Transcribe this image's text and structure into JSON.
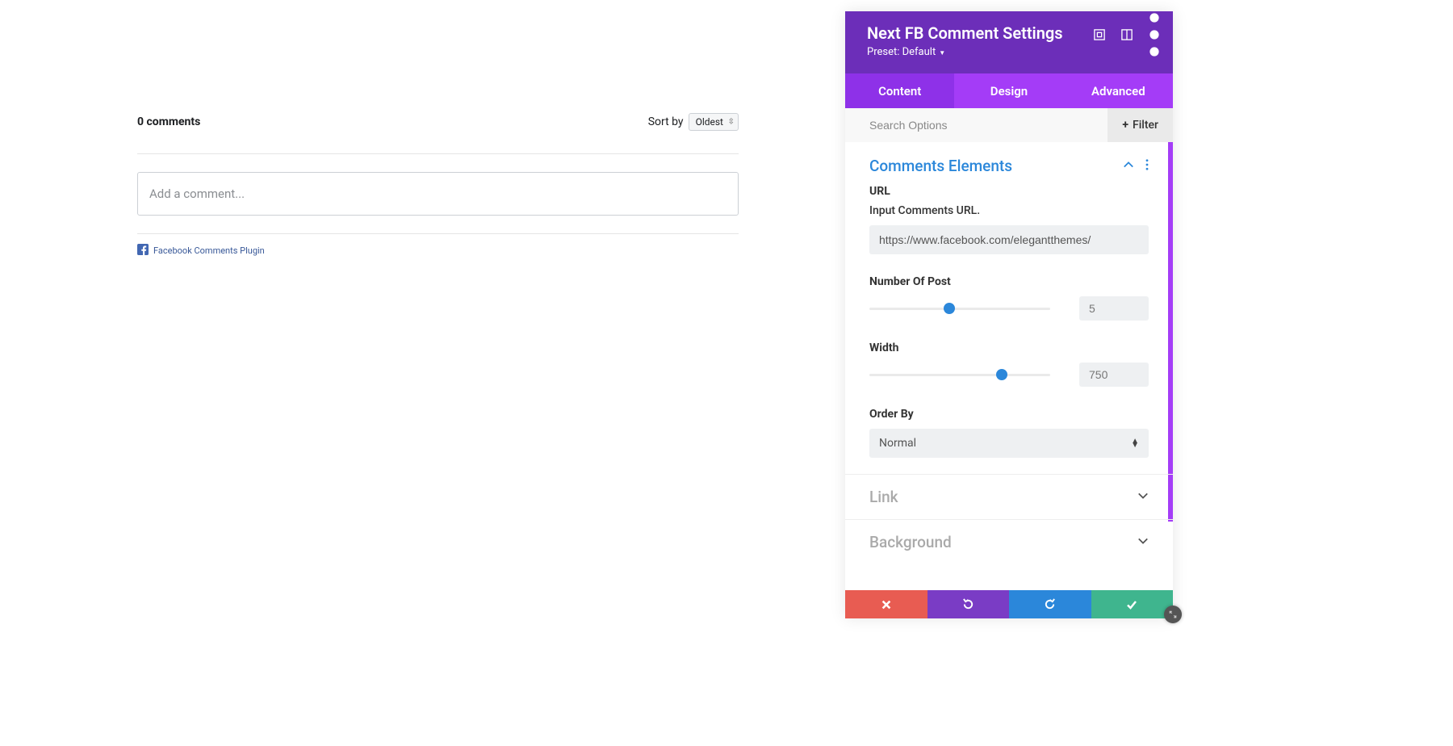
{
  "preview": {
    "count_label": "0 comments",
    "sort_by_label": "Sort by",
    "sort_value": "Oldest",
    "comment_placeholder": "Add a comment...",
    "plugin_link": "Facebook Comments Plugin"
  },
  "panel": {
    "title": "Next FB Comment Settings",
    "preset_label": "Preset: Default",
    "tabs": {
      "content": "Content",
      "design": "Design",
      "advanced": "Advanced"
    },
    "search_placeholder": "Search Options",
    "filter_label": "Filter",
    "sections": {
      "comments_elements": {
        "title": "Comments Elements",
        "url_label": "URL",
        "url_sublabel": "Input Comments URL.",
        "url_value": "https://www.facebook.com/elegantthemes/",
        "num_post_label": "Number Of Post",
        "num_post_value": "5",
        "num_post_percent": 44,
        "width_label": "Width",
        "width_value": "750",
        "width_percent": 73,
        "order_by_label": "Order By",
        "order_by_value": "Normal"
      },
      "link": {
        "title": "Link"
      },
      "background": {
        "title": "Background"
      }
    }
  }
}
